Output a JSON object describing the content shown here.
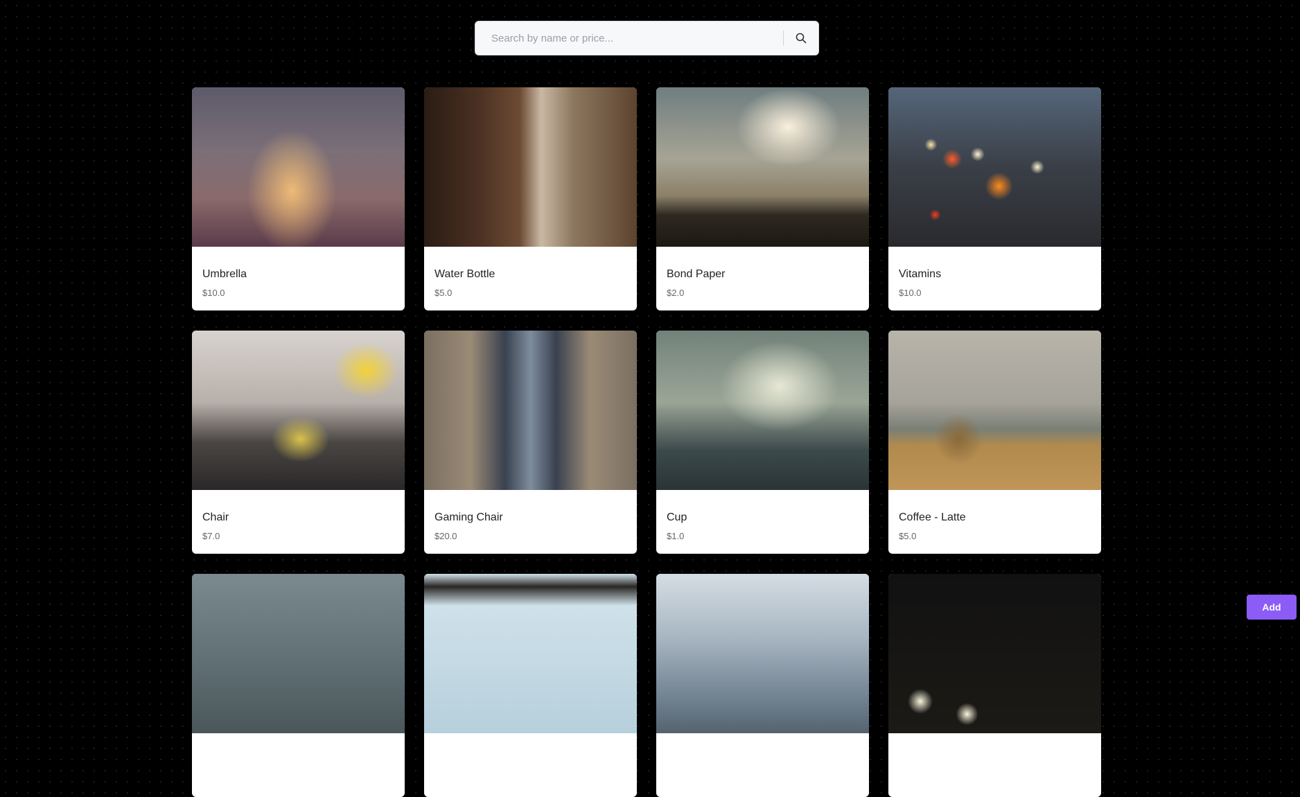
{
  "search": {
    "placeholder": "Search by name or price...",
    "value": "",
    "icon": "search-icon"
  },
  "products": [
    {
      "name": "Umbrella",
      "price": "$10.0",
      "image": "foggy-railway-platform"
    },
    {
      "name": "Water Bottle",
      "price": "$5.0",
      "image": "city-alley-buildings"
    },
    {
      "name": "Bond Paper",
      "price": "$2.0",
      "image": "sunlit-clouds-hills"
    },
    {
      "name": "Vitamins",
      "price": "$10.0",
      "image": "city-bokeh-lights"
    },
    {
      "name": "Chair",
      "price": "$7.0",
      "image": "tea-press-flowers"
    },
    {
      "name": "Gaming Chair",
      "price": "$20.0",
      "image": "railway-tracks-walls"
    },
    {
      "name": "Cup",
      "price": "$1.0",
      "image": "foggy-forest-tracks"
    },
    {
      "name": "Coffee - Latte",
      "price": "$5.0",
      "image": "hay-bale-field"
    },
    {
      "name": "",
      "price": "",
      "image": "misty-pine-forest"
    },
    {
      "name": "",
      "price": "",
      "image": "bridge-underside-sky"
    },
    {
      "name": "",
      "price": "",
      "image": "mountain-range"
    },
    {
      "name": "",
      "price": "",
      "image": "street-lamps-night"
    }
  ],
  "add_button": {
    "label": "Add"
  },
  "colors": {
    "background": "#000000",
    "card": "#ffffff",
    "accent": "#8b5cf6"
  }
}
